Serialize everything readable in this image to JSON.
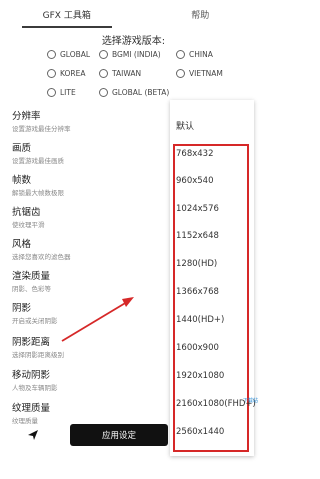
{
  "tabs": [
    {
      "label": "GFX 工具箱"
    },
    {
      "label": "帮助"
    }
  ],
  "version": {
    "title": "选择游戏版本:",
    "options": [
      "GLOBAL",
      "BGMI (INDIA)",
      "CHINA",
      "KOREA",
      "TAIWAN",
      "VIETNAM",
      "LITE",
      "GLOBAL (BETA)"
    ]
  },
  "settings": [
    {
      "title": "分辨率",
      "subtitle": "设置游戏最佳分辨率"
    },
    {
      "title": "画质",
      "subtitle": "设置游戏最佳画质"
    },
    {
      "title": "帧数",
      "subtitle": "解锁最大帧数极限"
    },
    {
      "title": "抗锯齿",
      "subtitle": "使纹理平滑"
    },
    {
      "title": "风格",
      "subtitle": "选择您喜欢的滤色器"
    },
    {
      "title": "渲染质量",
      "subtitle": "阴影、色彩等"
    },
    {
      "title": "阴影",
      "subtitle": "开启或关闭阴影"
    },
    {
      "title": "阴影距离",
      "subtitle": "选择阴影距离级别"
    },
    {
      "title": "移动阴影",
      "subtitle": "人物及车辆阴影"
    },
    {
      "title": "纹理质量",
      "subtitle": "纹理质量"
    }
  ],
  "dropdown": {
    "header": "默认",
    "options": [
      "768x432",
      "960x540",
      "1024x576",
      "1152x648",
      "1280(HD)",
      "1366x768",
      "1440(HD+)",
      "1600x900",
      "1920x1080",
      "2160x1080(FHD+)",
      "2560x1440"
    ]
  },
  "apply_label": "应用设定",
  "watermark": "下载站",
  "colors": {
    "highlight": "#d62828",
    "button": "#111111"
  }
}
